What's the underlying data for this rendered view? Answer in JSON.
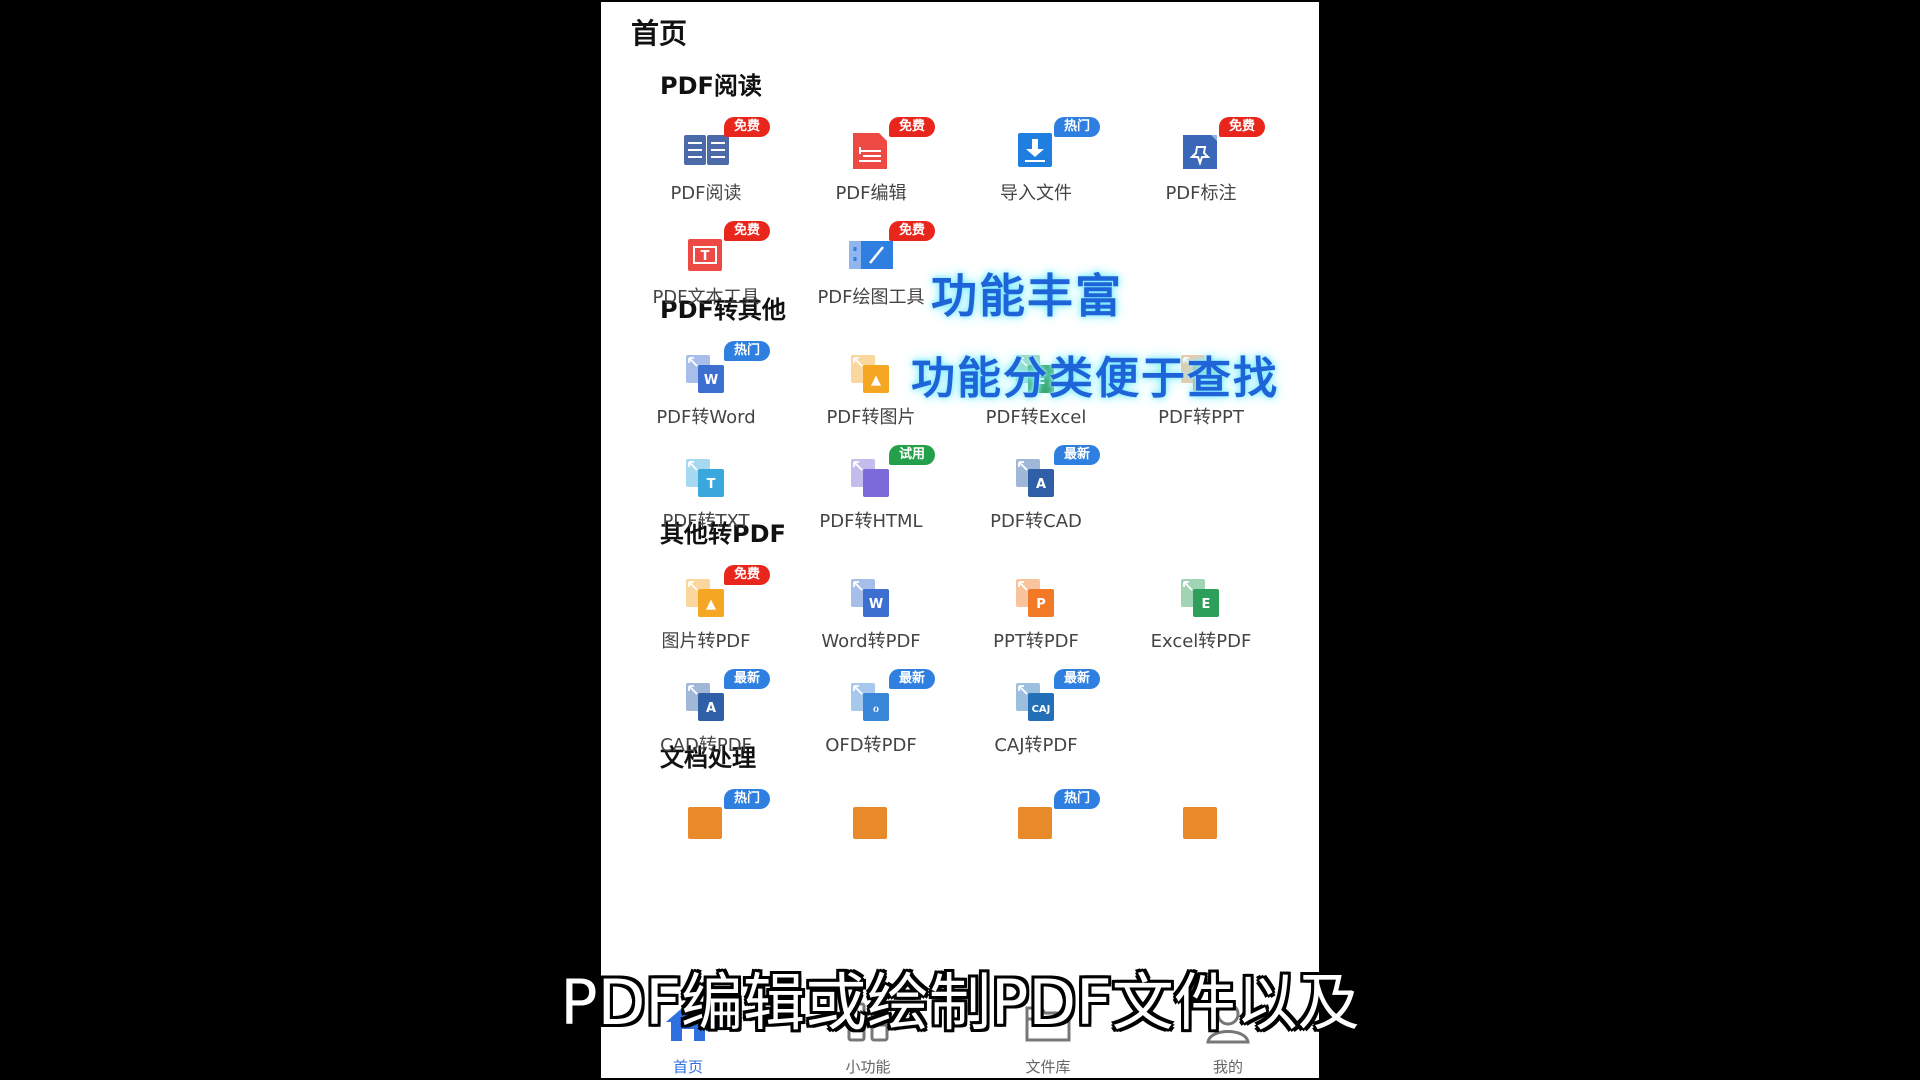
{
  "page_title": "首页",
  "sections": [
    {
      "title": "PDF阅读",
      "items": [
        {
          "label": "PDF阅读",
          "icon": "book-icon",
          "badge": "免费"
        },
        {
          "label": "PDF编辑",
          "icon": "edit-doc-icon",
          "badge": "免费"
        },
        {
          "label": "导入文件",
          "icon": "import-icon",
          "badge": "热门"
        },
        {
          "label": "PDF标注",
          "icon": "pin-icon",
          "badge": "免费"
        },
        {
          "label": "PDF文本工具",
          "icon": "text-tool-icon",
          "badge": "免费"
        },
        {
          "label": "PDF绘图工具",
          "icon": "draw-tool-icon",
          "badge": "免费"
        }
      ]
    },
    {
      "title": "PDF转其他",
      "items": [
        {
          "label": "PDF转Word",
          "icon": "word-icon",
          "badge": "热门",
          "letter": "W"
        },
        {
          "label": "PDF转图片",
          "icon": "image-icon",
          "badge": "",
          "letter": "▲"
        },
        {
          "label": "PDF转Excel",
          "icon": "excel-icon",
          "badge": "",
          "letter": "E"
        },
        {
          "label": "PDF转PPT",
          "icon": "ppt-icon",
          "badge": "",
          "letter": "P"
        },
        {
          "label": "PDF转TXT",
          "icon": "txt-icon",
          "badge": "",
          "letter": "T"
        },
        {
          "label": "PDF转HTML",
          "icon": "html-icon",
          "badge": "试用",
          "letter": "</>"
        },
        {
          "label": "PDF转CAD",
          "icon": "cad-icon",
          "badge": "最新",
          "letter": "A"
        }
      ]
    },
    {
      "title": "其他转PDF",
      "items": [
        {
          "label": "图片转PDF",
          "icon": "image-icon",
          "badge": "免费",
          "letter": "▲"
        },
        {
          "label": "Word转PDF",
          "icon": "word-icon",
          "badge": "",
          "letter": "W"
        },
        {
          "label": "PPT转PDF",
          "icon": "ppt-icon",
          "badge": "",
          "letter": "P"
        },
        {
          "label": "Excel转PDF",
          "icon": "excel-icon",
          "badge": "",
          "letter": "E"
        },
        {
          "label": "CAD转PDF",
          "icon": "cad-icon",
          "badge": "最新",
          "letter": "A"
        },
        {
          "label": "OFD转PDF",
          "icon": "ofd-icon",
          "badge": "最新",
          "letter": "ℴ"
        },
        {
          "label": "CAJ转PDF",
          "icon": "caj-icon",
          "badge": "最新",
          "letter": "CAJ"
        }
      ]
    },
    {
      "title": "文档处理",
      "items": [
        {
          "label": "",
          "icon": "doc-tool-icon",
          "badge": "热门"
        },
        {
          "label": "",
          "icon": "doc-tool-icon",
          "badge": ""
        },
        {
          "label": "",
          "icon": "doc-tool-icon",
          "badge": "热门"
        },
        {
          "label": "",
          "icon": "doc-tool-icon",
          "badge": ""
        }
      ]
    }
  ],
  "overlay": {
    "line1": "功能丰富",
    "line2": "功能分类便于查找"
  },
  "nav": [
    {
      "label": "首页",
      "icon": "home-icon",
      "active": true
    },
    {
      "label": "小功能",
      "icon": "grid-icon",
      "active": false
    },
    {
      "label": "文件库",
      "icon": "folder-icon",
      "active": false
    },
    {
      "label": "我的",
      "icon": "user-icon",
      "active": false
    }
  ],
  "subtitle": "PDF编辑或绘制PDF文件以及",
  "colors": {
    "badge_free": "#e8261c",
    "badge_hot": "#2f7fe0",
    "badge_trial": "#25a04a",
    "badge_new": "#2f7fe0",
    "word": "#3d6fd1",
    "excel": "#2e9e5b",
    "ppt": "#f27a26",
    "image": "#f5a623",
    "txt": "#3aa8dd",
    "html": "#7b6ad8",
    "cad": "#2f5fa6",
    "ofd": "#3a86d8",
    "caj": "#2370b8",
    "red": "#ee4a44",
    "nav_active": "#2f6fe0"
  }
}
